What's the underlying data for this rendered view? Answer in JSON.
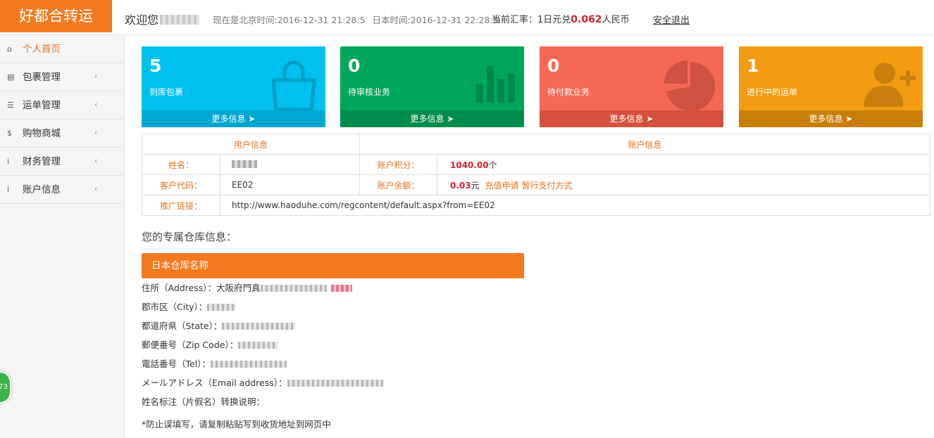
{
  "header": {
    "logo": "好都合转运",
    "welcome": "欢迎您",
    "beijing_time": "现在是北京时间:2016-12-31 21:28:5",
    "japan_time": "日本时间:2016-12-31 22:28:5",
    "rate_prefix": "当前汇率：1日元兑",
    "rate_value": "0.062",
    "rate_suffix": "人民币",
    "logout": "安全退出"
  },
  "sidebar": {
    "items": [
      {
        "label": "个人首页",
        "icon": "home-icon"
      },
      {
        "label": "包裹管理",
        "icon": "inbox-icon"
      },
      {
        "label": "运单管理",
        "icon": "list-icon"
      },
      {
        "label": "购物商城",
        "icon": "dollar-icon"
      },
      {
        "label": "财务管理",
        "icon": "info-icon"
      },
      {
        "label": "账户信息",
        "icon": "info-icon"
      }
    ]
  },
  "stats": [
    {
      "value": "5",
      "label": "到库包裹",
      "more": "更多信息",
      "icon": "shopping-bag-icon",
      "color": "#00c0ef"
    },
    {
      "value": "0",
      "label": "待审核业务",
      "more": "更多信息",
      "icon": "bar-chart-icon",
      "color": "#00a65a"
    },
    {
      "value": "0",
      "label": "待付款业务",
      "more": "更多信息",
      "icon": "pie-chart-icon",
      "color": "#f56954"
    },
    {
      "value": "1",
      "label": "进行中的运单",
      "more": "更多信息",
      "icon": "user-add-icon",
      "color": "#f39c12"
    }
  ],
  "info": {
    "user_header": "用户信息",
    "account_header": "账户信息",
    "name_label": "姓名：",
    "points_label": "账户积分：",
    "points_value": "1040.00",
    "points_unit": "个",
    "code_label": "客户代码：",
    "code_value": "EE02",
    "balance_label": "账户余额：",
    "balance_value": "0.03",
    "balance_unit": "元",
    "recharge": "充值申请",
    "pay_method": "暂行支付方式",
    "link_label": "推广链接：",
    "link_value": "http://www.haoduhe.com/regcontent/default.aspx?from=EE02"
  },
  "warehouse": {
    "section_title": "您的专属仓库信息：",
    "panel_title": "日本仓库名称",
    "address": "住所（Address）：大阪府門真",
    "city": "郡市区（City）：",
    "state": "都道府県（State）：",
    "zip": "郵便番号（Zip Code）：",
    "tel": "電話番号（Tel）：",
    "email": "メールアドレス（Email address）：",
    "kana": "姓名标注（片假名）转换说明：",
    "note": "*防止误填写，请复制粘贴写到收货地址到网页中"
  },
  "badge": "73"
}
